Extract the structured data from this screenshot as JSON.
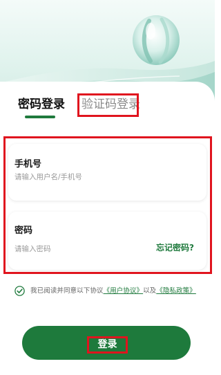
{
  "header": {
    "logo_icon": "water-drop-logo-icon",
    "brand_colors": {
      "primary": "#1e7a3c",
      "highlight": "#e0141e",
      "mint": "#cfeae2"
    }
  },
  "tabs": {
    "password_login": "密码登录",
    "code_login": "验证码登录",
    "active": "password_login"
  },
  "form": {
    "account": {
      "label": "手机号",
      "value": "",
      "placeholder": "请输入用户名/手机号"
    },
    "password": {
      "label": "密码",
      "value": "",
      "placeholder": "请输入密码",
      "forgot_label": "忘记密码?"
    }
  },
  "agreement": {
    "checked": true,
    "check_icon": "check-circle-icon",
    "prefix": "我已阅读并同意以下协议",
    "user_agreement": "《用户协议》",
    "joiner": "以及",
    "privacy_policy": "《隐私政策》"
  },
  "actions": {
    "login_label": "登录"
  }
}
